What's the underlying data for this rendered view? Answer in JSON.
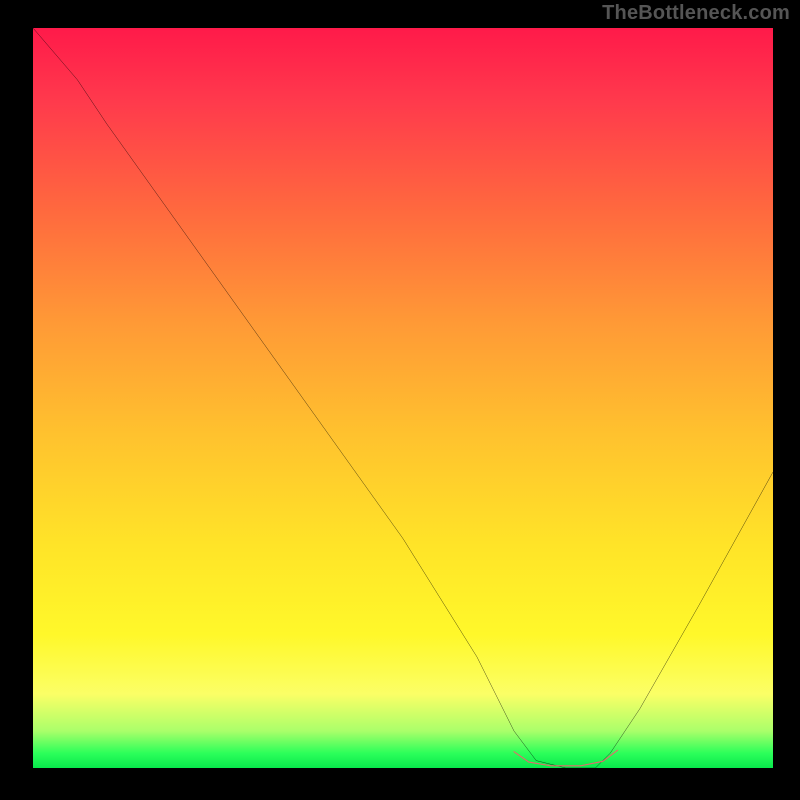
{
  "watermark": "TheBottleneck.com",
  "chart_data": {
    "type": "line",
    "title": "",
    "xlabel": "",
    "ylabel": "",
    "xlim": [
      0,
      100
    ],
    "ylim": [
      0,
      100
    ],
    "grid": false,
    "legend": false,
    "series": [
      {
        "name": "bottleneck-curve",
        "x": [
          0,
          6,
          10,
          20,
          30,
          40,
          50,
          60,
          65,
          68,
          72,
          76,
          78,
          82,
          90,
          100
        ],
        "y": [
          100,
          93,
          87,
          73,
          59,
          45,
          31,
          15,
          5,
          1,
          0,
          0,
          2,
          8,
          22,
          40
        ]
      },
      {
        "name": "optimal-range-marker",
        "x": [
          65,
          67,
          70,
          74,
          77,
          79
        ],
        "y": [
          2.2,
          0.8,
          0.3,
          0.3,
          0.9,
          2.4
        ]
      }
    ],
    "gradient_stops": [
      {
        "pos": 0,
        "color": "#ff1a4a"
      },
      {
        "pos": 10,
        "color": "#ff3a4c"
      },
      {
        "pos": 25,
        "color": "#ff6a3e"
      },
      {
        "pos": 40,
        "color": "#ff9a36"
      },
      {
        "pos": 55,
        "color": "#ffc22e"
      },
      {
        "pos": 70,
        "color": "#ffe428"
      },
      {
        "pos": 82,
        "color": "#fff82a"
      },
      {
        "pos": 90,
        "color": "#fbff66"
      },
      {
        "pos": 95,
        "color": "#aaff6a"
      },
      {
        "pos": 98,
        "color": "#2cff5a"
      },
      {
        "pos": 100,
        "color": "#08e84c"
      }
    ],
    "colors": {
      "curve": "#000000",
      "marker": "#e36b6b",
      "frame": "#000000"
    }
  }
}
